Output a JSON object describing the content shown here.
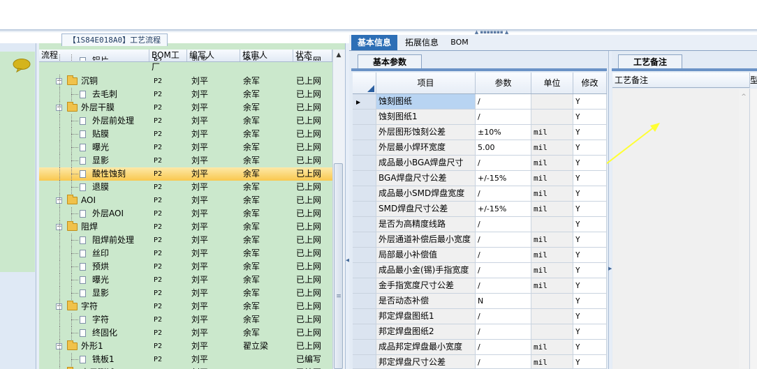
{
  "tree_panel": {
    "title": "【1S84E018A0】工艺流程",
    "columns": [
      "流程",
      "BOM工厂",
      "编写人",
      "核审人",
      "状态"
    ],
    "rows": [
      {
        "name": "铝片",
        "level": 2,
        "type": "leaf",
        "bom": "P2",
        "writer": "刘平",
        "reviewer": "余军",
        "status": "已上网",
        "partial": true
      },
      {
        "name": "沉铜",
        "level": 1,
        "type": "folder",
        "bom": "P2",
        "writer": "刘平",
        "reviewer": "余军",
        "status": "已上网"
      },
      {
        "name": "去毛刺",
        "level": 2,
        "type": "leaf",
        "bom": "P2",
        "writer": "刘平",
        "reviewer": "余军",
        "status": "已上网"
      },
      {
        "name": "外层干膜",
        "level": 1,
        "type": "folder",
        "bom": "P2",
        "writer": "刘平",
        "reviewer": "余军",
        "status": "已上网"
      },
      {
        "name": "外层前处理",
        "level": 2,
        "type": "leaf",
        "bom": "P2",
        "writer": "刘平",
        "reviewer": "余军",
        "status": "已上网"
      },
      {
        "name": "贴膜",
        "level": 2,
        "type": "leaf",
        "bom": "P2",
        "writer": "刘平",
        "reviewer": "余军",
        "status": "已上网"
      },
      {
        "name": "曝光",
        "level": 2,
        "type": "leaf",
        "bom": "P2",
        "writer": "刘平",
        "reviewer": "余军",
        "status": "已上网"
      },
      {
        "name": "显影",
        "level": 2,
        "type": "leaf",
        "bom": "P2",
        "writer": "刘平",
        "reviewer": "余军",
        "status": "已上网"
      },
      {
        "name": "酸性蚀刻",
        "level": 2,
        "type": "leaf",
        "bom": "P2",
        "writer": "刘平",
        "reviewer": "余军",
        "status": "已上网",
        "selected": true
      },
      {
        "name": "退膜",
        "level": 2,
        "type": "leaf",
        "bom": "P2",
        "writer": "刘平",
        "reviewer": "余军",
        "status": "已上网"
      },
      {
        "name": "AOI",
        "level": 1,
        "type": "folder",
        "bom": "P2",
        "writer": "刘平",
        "reviewer": "余军",
        "status": "已上网"
      },
      {
        "name": "外层AOI",
        "level": 2,
        "type": "leaf",
        "bom": "P2",
        "writer": "刘平",
        "reviewer": "余军",
        "status": "已上网"
      },
      {
        "name": "阻焊",
        "level": 1,
        "type": "folder",
        "bom": "P2",
        "writer": "刘平",
        "reviewer": "余军",
        "status": "已上网"
      },
      {
        "name": "阻焊前处理",
        "level": 2,
        "type": "leaf",
        "bom": "P2",
        "writer": "刘平",
        "reviewer": "余军",
        "status": "已上网"
      },
      {
        "name": "丝印",
        "level": 2,
        "type": "leaf",
        "bom": "P2",
        "writer": "刘平",
        "reviewer": "余军",
        "status": "已上网"
      },
      {
        "name": "预烘",
        "level": 2,
        "type": "leaf",
        "bom": "P2",
        "writer": "刘平",
        "reviewer": "余军",
        "status": "已上网"
      },
      {
        "name": "曝光",
        "level": 2,
        "type": "leaf",
        "bom": "P2",
        "writer": "刘平",
        "reviewer": "余军",
        "status": "已上网"
      },
      {
        "name": "显影",
        "level": 2,
        "type": "leaf",
        "bom": "P2",
        "writer": "刘平",
        "reviewer": "余军",
        "status": "已上网"
      },
      {
        "name": "字符",
        "level": 1,
        "type": "folder",
        "bom": "P2",
        "writer": "刘平",
        "reviewer": "余军",
        "status": "已上网"
      },
      {
        "name": "字符",
        "level": 2,
        "type": "leaf",
        "bom": "P2",
        "writer": "刘平",
        "reviewer": "余军",
        "status": "已上网"
      },
      {
        "name": "终固化",
        "level": 2,
        "type": "leaf",
        "bom": "P2",
        "writer": "刘平",
        "reviewer": "余军",
        "status": "已上网"
      },
      {
        "name": "外形1",
        "level": 1,
        "type": "folder",
        "bom": "P2",
        "writer": "刘平",
        "reviewer": "翟立梁",
        "status": "已上网"
      },
      {
        "name": "铣板1",
        "level": 2,
        "type": "leaf",
        "bom": "P2",
        "writer": "刘平",
        "reviewer": "",
        "status": "已编写"
      },
      {
        "name": "电子测试",
        "level": 1,
        "type": "folder",
        "bom": "P2",
        "writer": "刘平",
        "reviewer": "",
        "status": "已编写",
        "partial": true
      }
    ]
  },
  "main_tabs": [
    "基本信息",
    "拓展信息",
    "BOM"
  ],
  "params_panel": {
    "subtab": "基本参数",
    "columns": [
      "项目",
      "参数",
      "单位",
      "修改"
    ],
    "rows": [
      {
        "item": "蚀刻图纸",
        "value": "/",
        "unit": "",
        "mod": "Y",
        "current": true
      },
      {
        "item": "蚀刻图纸1",
        "value": "/",
        "unit": "",
        "mod": "Y"
      },
      {
        "item": "外层图形蚀刻公差",
        "value": "±10%",
        "unit": "mil",
        "mod": "Y"
      },
      {
        "item": "外层最小焊环宽度",
        "value": "5.00",
        "unit": "mil",
        "mod": "Y"
      },
      {
        "item": "成品最小BGA焊盘尺寸",
        "value": "/",
        "unit": "mil",
        "mod": "Y"
      },
      {
        "item": "BGA焊盘尺寸公差",
        "value": "+/-15%",
        "unit": "mil",
        "mod": "Y"
      },
      {
        "item": "成品最小SMD焊盘宽度",
        "value": "/",
        "unit": "mil",
        "mod": "Y"
      },
      {
        "item": "SMD焊盘尺寸公差",
        "value": "+/-15%",
        "unit": "mil",
        "mod": "Y"
      },
      {
        "item": "是否为高精度线路",
        "value": "/",
        "unit": "",
        "mod": "Y"
      },
      {
        "item": "外层通道补偿后最小宽度",
        "value": "/",
        "unit": "mil",
        "mod": "Y"
      },
      {
        "item": "局部最小补偿值",
        "value": "/",
        "unit": "mil",
        "mod": "Y"
      },
      {
        "item": "成品最小金(锡)手指宽度",
        "value": "/",
        "unit": "mil",
        "mod": "Y"
      },
      {
        "item": "金手指宽度尺寸公差",
        "value": "/",
        "unit": "mil",
        "mod": "Y"
      },
      {
        "item": "是否动态补偿",
        "value": "N",
        "unit": "",
        "mod": "Y"
      },
      {
        "item": "邦定焊盘图纸1",
        "value": "/",
        "unit": "",
        "mod": "Y"
      },
      {
        "item": "邦定焊盘图纸2",
        "value": "/",
        "unit": "",
        "mod": "Y"
      },
      {
        "item": "成品邦定焊盘最小宽度",
        "value": "/",
        "unit": "mil",
        "mod": "Y"
      },
      {
        "item": "邦定焊盘尺寸公差",
        "value": "/",
        "unit": "mil",
        "mod": "Y"
      }
    ]
  },
  "notes_panel": {
    "subtab": "工艺备注",
    "column": "工艺备注",
    "column2": "型"
  },
  "colors": {
    "tree_bg": "#cbe8cc",
    "tab_active": "#2d6fb6",
    "selected_row": "#f9c84f",
    "arrow": "#ffff33"
  }
}
